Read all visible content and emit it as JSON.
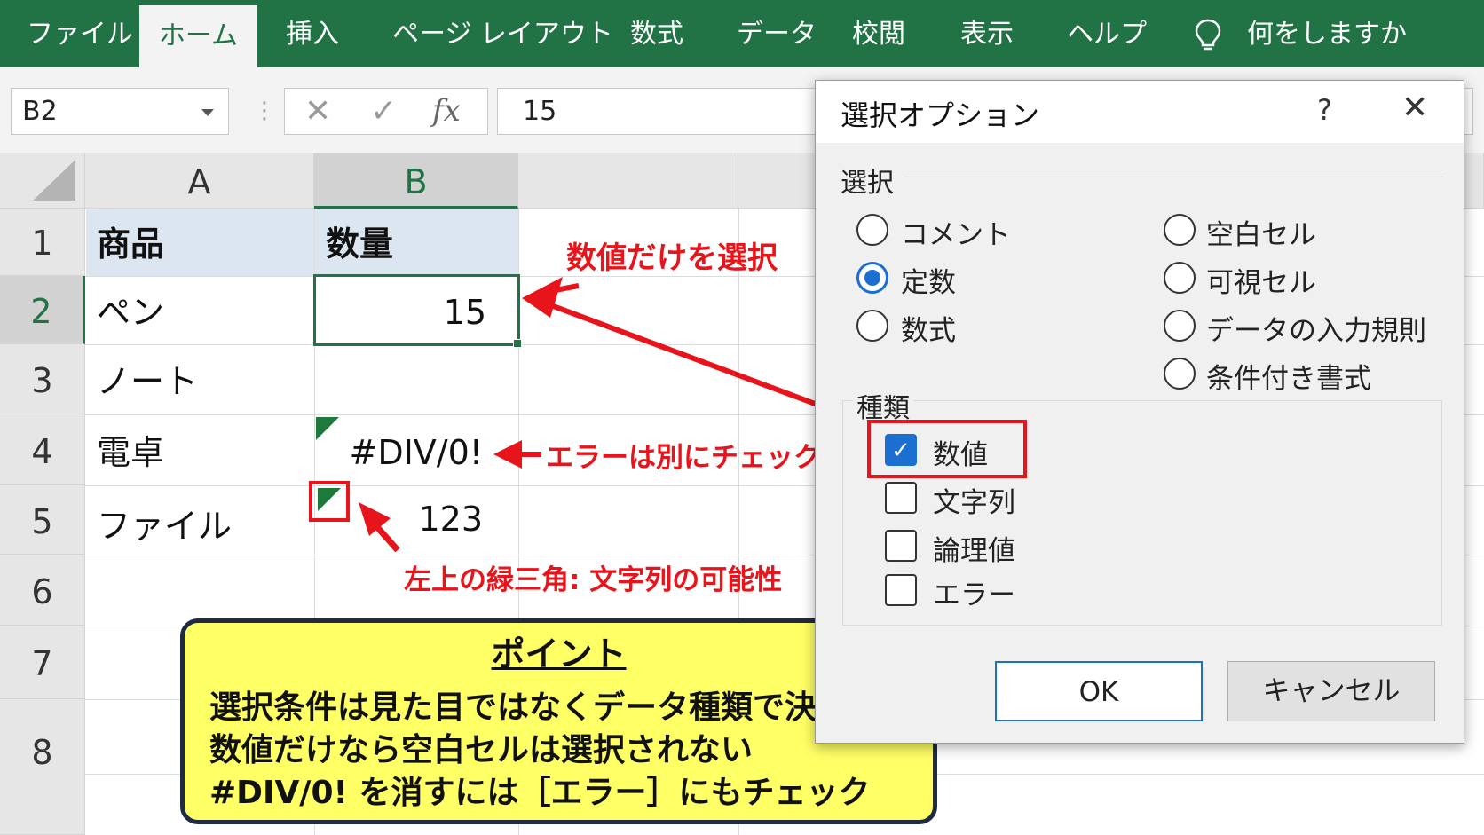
{
  "ribbon": {
    "tabs": [
      {
        "label": "ファイル",
        "active": false
      },
      {
        "label": "ホーム",
        "active": true
      },
      {
        "label": "挿入",
        "active": false
      },
      {
        "label": "ページ レイアウト",
        "active": false
      },
      {
        "label": "数式",
        "active": false
      },
      {
        "label": "データ",
        "active": false
      },
      {
        "label": "校閲",
        "active": false
      },
      {
        "label": "表示",
        "active": false
      },
      {
        "label": "ヘルプ",
        "active": false
      }
    ],
    "search_label": "何をしますか",
    "accent_color": "#217346"
  },
  "formula_bar": {
    "name_box": "B2",
    "cancel": "✕",
    "enter": "✓",
    "fx": "fx",
    "value": "15"
  },
  "sheet": {
    "columns": [
      "A",
      "B"
    ],
    "rows": [
      "1",
      "2",
      "3",
      "4",
      "5",
      "6",
      "7",
      "8"
    ],
    "cells": {
      "A1": "商品",
      "B1": "数量",
      "A2": "ペン",
      "B2": "15",
      "A3": "ノート",
      "A4": "電卓",
      "B4": "#DIV/0!",
      "A5": "ファイル",
      "B5": "123"
    }
  },
  "annotations": {
    "numbers_only": "数値だけを選択",
    "error_separate": "エラーは別にチェック",
    "green_triangle": "左上の緑三角: 文字列の可能性"
  },
  "point_box": {
    "title": "ポイント",
    "lines": [
      "選択条件は見た目ではなくデータ種類で決める",
      "数値だけなら空白セルは選択されない",
      "#DIV/0! を消すには［エラー］にもチェック"
    ]
  },
  "dialog": {
    "title": "選択オプション",
    "help": "?",
    "close": "✕",
    "select_group": "選択",
    "options_left": [
      {
        "label": "コメント",
        "checked": false
      },
      {
        "label": "定数",
        "checked": true
      },
      {
        "label": "数式",
        "checked": false
      }
    ],
    "options_right": [
      {
        "label": "空白セル",
        "checked": false
      },
      {
        "label": "可視セル",
        "checked": false
      },
      {
        "label": "データの入力規則",
        "checked": false
      },
      {
        "label": "条件付き書式",
        "checked": false
      }
    ],
    "types_group": "種類",
    "types": [
      {
        "label": "数値",
        "checked": true
      },
      {
        "label": "文字列",
        "checked": false
      },
      {
        "label": "論理値",
        "checked": false
      },
      {
        "label": "エラー",
        "checked": false
      }
    ],
    "ok": "OK",
    "cancel": "キャンセル",
    "check_glyph": "✓"
  }
}
